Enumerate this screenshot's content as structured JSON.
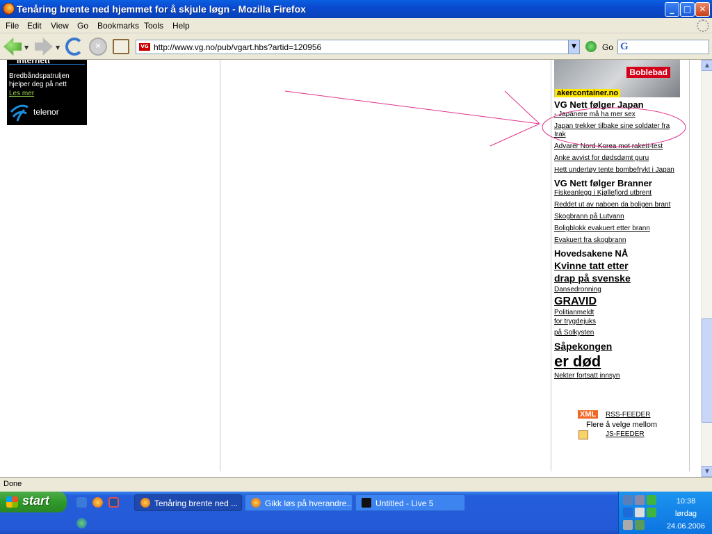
{
  "window": {
    "title": "Tenåring brente ned hjemmet for å skjule løgn - Mozilla Firefox",
    "min": "_",
    "max": "□",
    "close": "✕"
  },
  "menu": [
    "File",
    "Edit",
    "View",
    "Go",
    "Bookmarks",
    "Tools",
    "Help"
  ],
  "nav": {
    "url": "http://www.vg.no/pub/vgart.hbs?artid=120956",
    "site_badge": "VG",
    "go_label": "Go",
    "search_engine_glyph": "G"
  },
  "ads": {
    "telenor": {
      "heading": "Internett",
      "text": "Bredbåndspatruljen hjelper deg på nett",
      "more": "Les mer",
      "brand": "telenor"
    },
    "boblebad": {
      "label": "Boblebad",
      "domain": "akercontainer.no"
    }
  },
  "sidebar": {
    "japan": {
      "heading": "VG Nett følger Japan",
      "links": [
        "- Japanere må ha mer sex",
        "Japan trekker tilbake sine soldater fra Irak",
        "Advarer Nord-Korea mot rakett-test",
        "Anke avvist for dødsdømt guru",
        "Hett undertøy tente bombefrykt i Japan"
      ]
    },
    "branner": {
      "heading": "VG Nett følger Branner",
      "links": [
        "Fiskeanlegg i Kjøllefjord utbrent",
        "Reddet ut av naboen da boligen brant",
        "Skogbrann på Lutvann",
        "Boligblokk evakuert etter brann",
        "Evakuert fra skogbrann"
      ]
    },
    "hoved": {
      "heading": "Hovedsakene NÅ",
      "h1_line1": "Kvinne tatt etter",
      "h1_line2": "drap på svenske",
      "l1": "Dansedronning",
      "h2": "GRAVID",
      "l2_line1": "Politianmeldt",
      "l2_line2": "for trygdejuks",
      "l2_line3": "på Solkysten",
      "h3_line1": "Såpekongen",
      "h3_line2": "er død",
      "l3": "Nekter fortsatt innsyn"
    },
    "feeds": {
      "xml_badge": "XML",
      "rss": "RSS-FEEDER",
      "middle": "Flere å velge mellom",
      "js": "JS-FEEDER"
    }
  },
  "annotation_color": "#e0308a",
  "status": "Done",
  "taskbar": {
    "start": "start",
    "tasks": [
      {
        "label": "Tenåring brente ned ...",
        "active": true
      },
      {
        "label": "Gikk løs på hverandre...",
        "active": false
      },
      {
        "label": "Untitled - Live 5",
        "active": false
      }
    ],
    "clock_time": "10:38",
    "clock_day": "lørdag",
    "clock_date": "24.06.2006"
  }
}
